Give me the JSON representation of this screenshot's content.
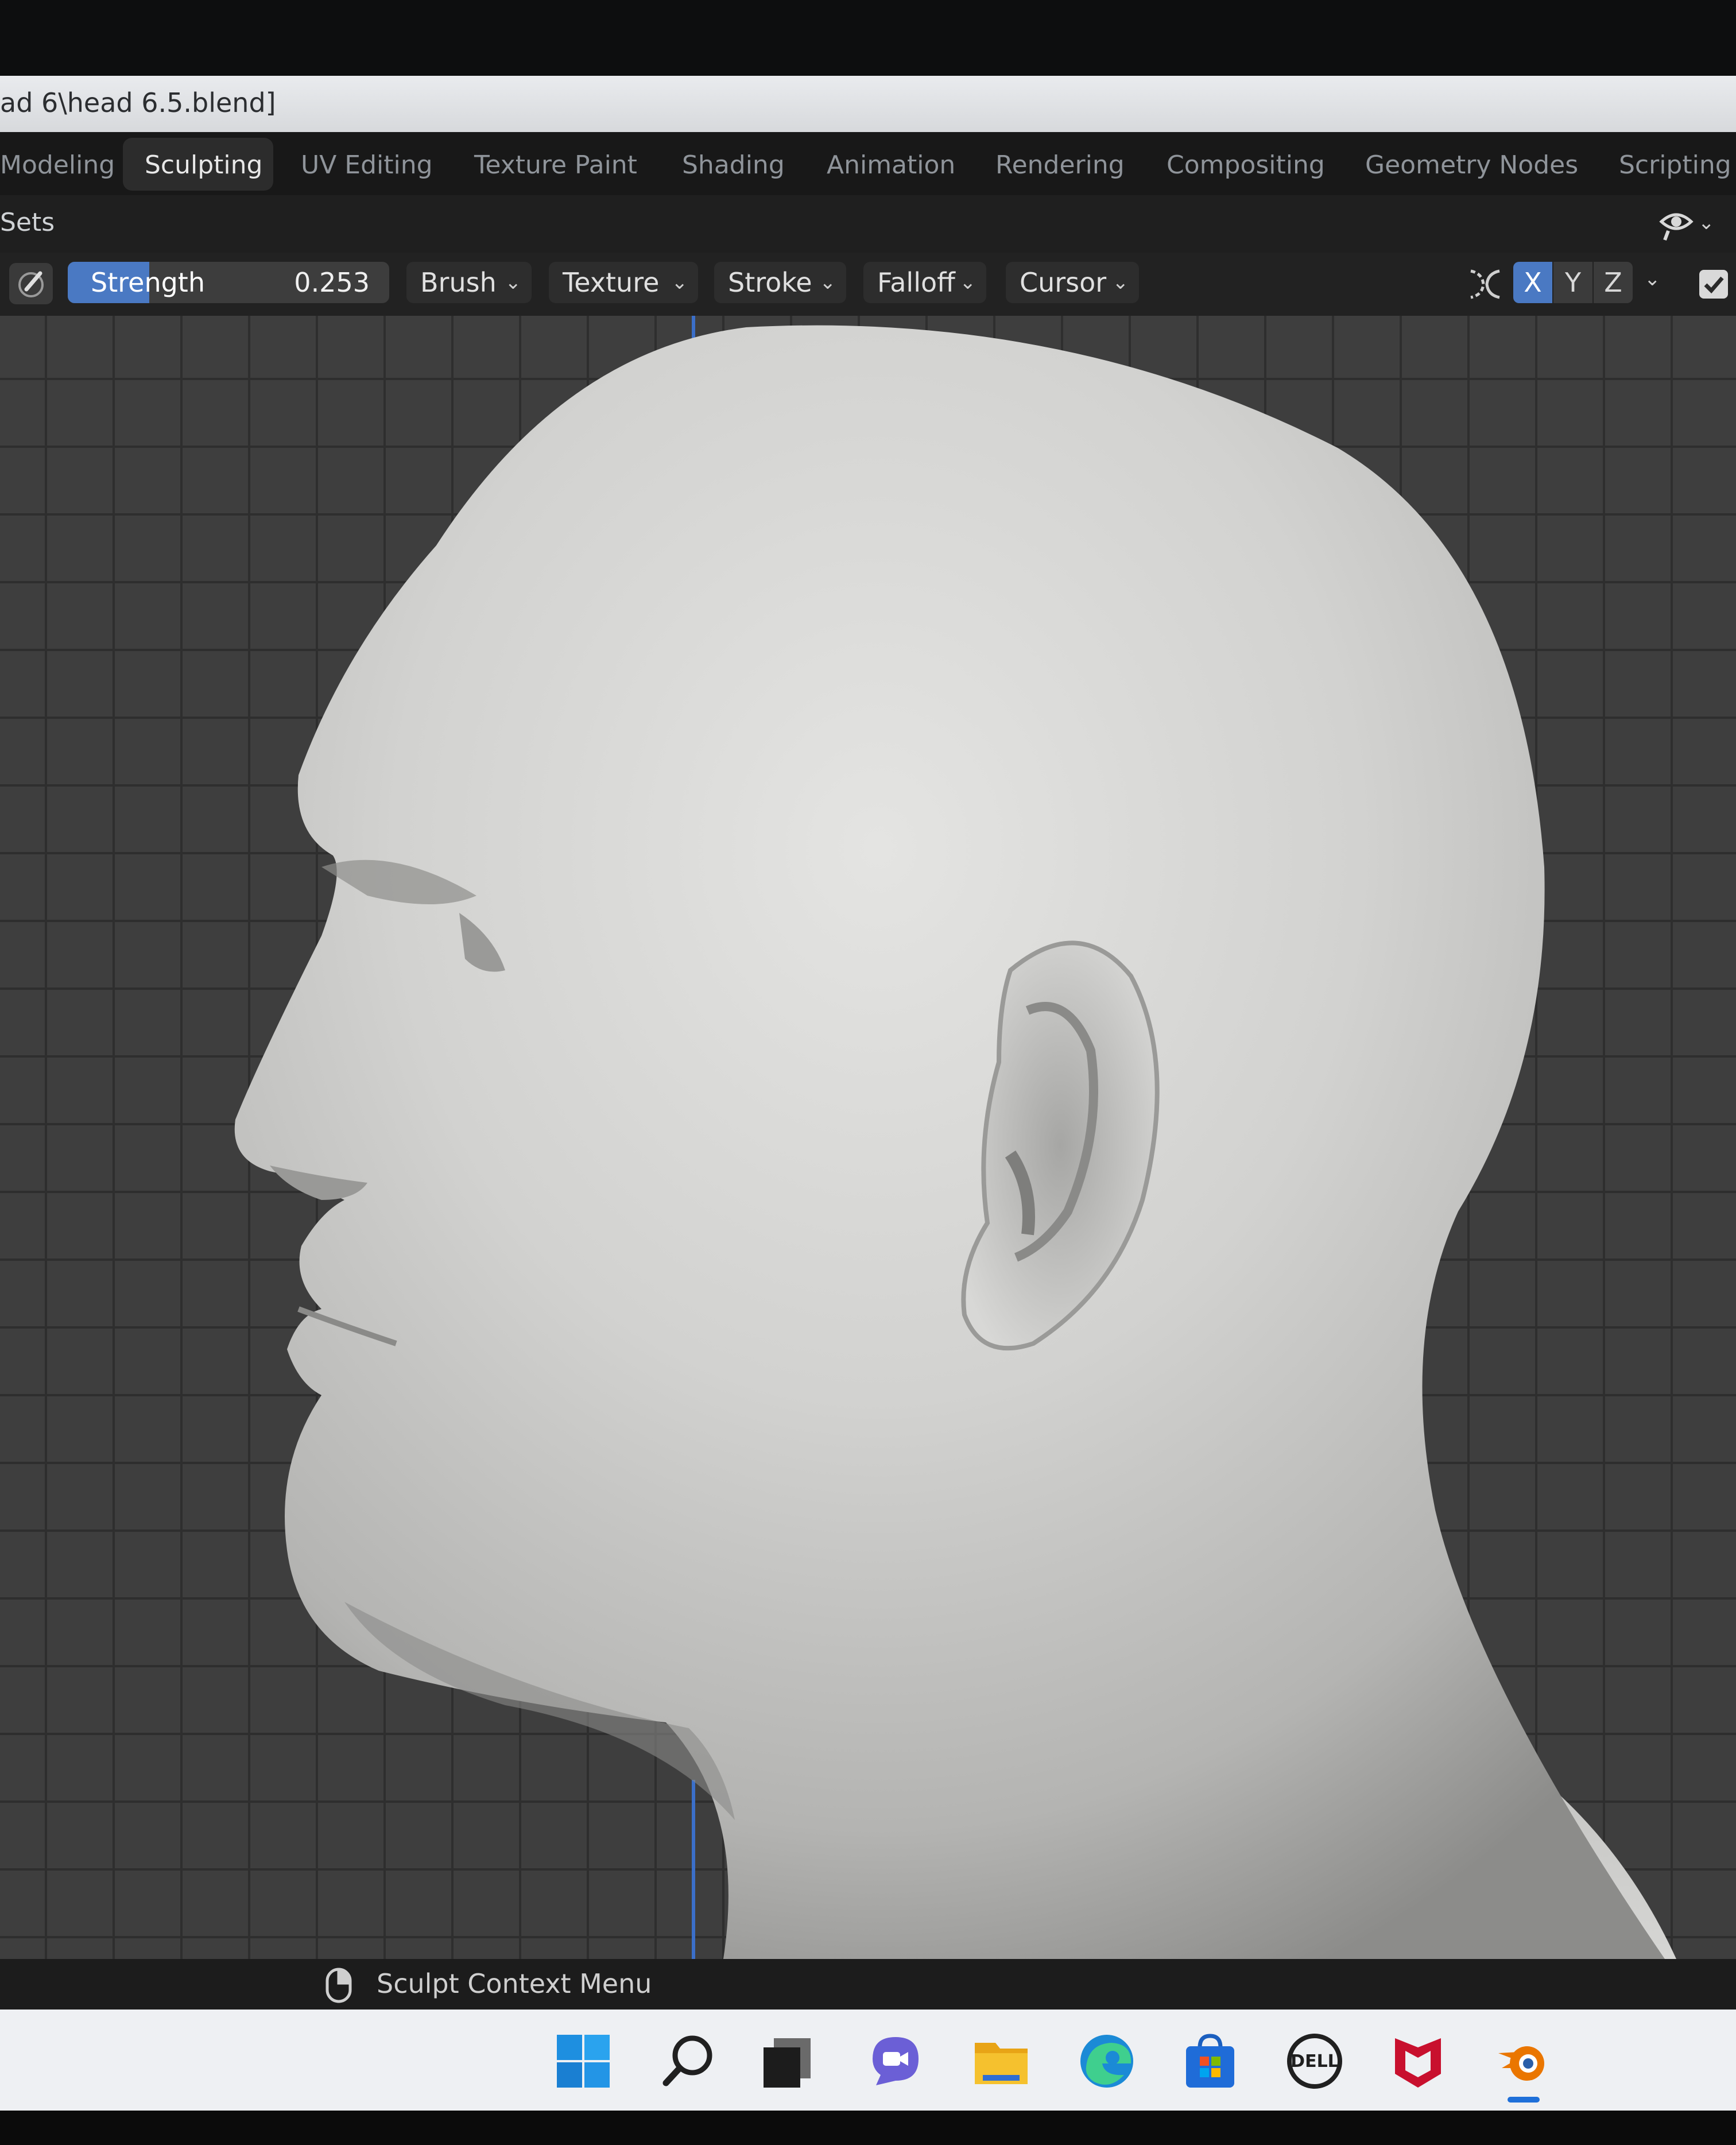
{
  "window": {
    "title": "ad 6\\head 6.5.blend]"
  },
  "workspace_tabs": [
    {
      "label": "Modeling",
      "active": false
    },
    {
      "label": "Sculpting",
      "active": true
    },
    {
      "label": "UV Editing",
      "active": false
    },
    {
      "label": "Texture Paint",
      "active": false
    },
    {
      "label": "Shading",
      "active": false
    },
    {
      "label": "Animation",
      "active": false
    },
    {
      "label": "Rendering",
      "active": false
    },
    {
      "label": "Compositing",
      "active": false
    },
    {
      "label": "Geometry Nodes",
      "active": false
    },
    {
      "label": "Scripting",
      "active": false
    }
  ],
  "header": {
    "sets_label": "Sets"
  },
  "tool_settings": {
    "strength_label": "Strength",
    "strength_value": "0.253",
    "strength_fraction": 0.253,
    "brush_label": "Brush",
    "texture_label": "Texture",
    "stroke_label": "Stroke",
    "falloff_label": "Falloff",
    "cursor_label": "Cursor",
    "symmetry": {
      "x_label": "X",
      "y_label": "Y",
      "z_label": "Z",
      "x_active": true
    }
  },
  "statusbar": {
    "hint": "Sculpt Context Menu"
  },
  "taskbar": {
    "icons": [
      "windows-start-icon",
      "search-icon",
      "task-view-icon",
      "chat-icon",
      "file-explorer-icon",
      "edge-icon",
      "store-icon",
      "dell-icon",
      "mcafee-icon",
      "blender-icon"
    ]
  },
  "colors": {
    "accent": "#4a79c3",
    "viewport_bg": "#3e3e3e",
    "grid": "#2e2e2e",
    "mesh": "#c9c9c9"
  }
}
